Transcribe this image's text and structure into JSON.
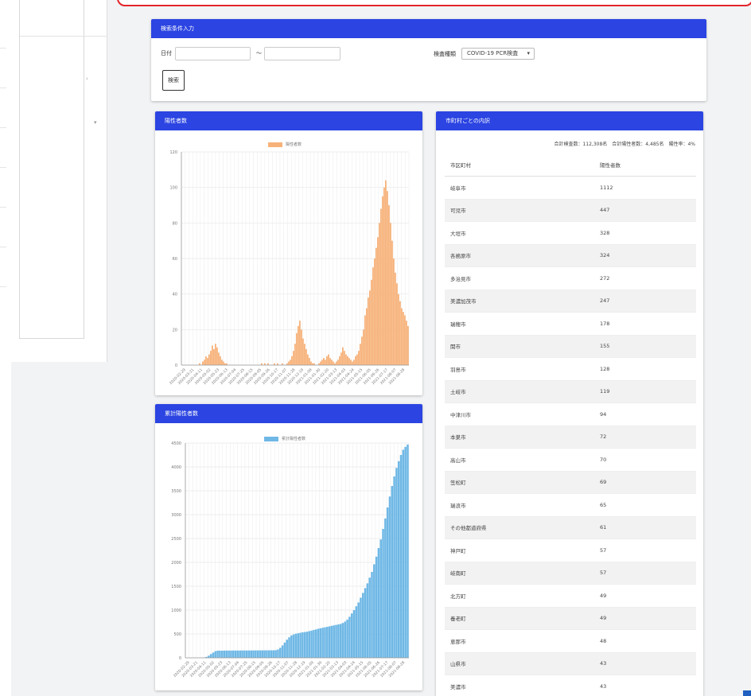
{
  "search": {
    "title": "検索条件入力",
    "date_label": "日付",
    "tilde": "〜",
    "type_label": "検査種類",
    "type_value": "COVID-19 PCR検査",
    "button": "検索"
  },
  "positive_chart": {
    "title": "陽性者数",
    "legend": "陽性者数",
    "color": "#f7b27a"
  },
  "cumulative_chart": {
    "title": "累計陽性者数",
    "legend": "累計陽性者数",
    "color": "#6fb8e6"
  },
  "municipal": {
    "title": "市町村ごとの内訳",
    "totals": "合計検査数：112,308名　合計陽性者数：4,485名　陽性率：4%",
    "headers": [
      "市区町村",
      "陽性者数"
    ],
    "rows": [
      [
        "岐阜市",
        "1112"
      ],
      [
        "可児市",
        "447"
      ],
      [
        "大垣市",
        "328"
      ],
      [
        "各務原市",
        "324"
      ],
      [
        "多治見市",
        "272"
      ],
      [
        "美濃加茂市",
        "247"
      ],
      [
        "瑞穂市",
        "178"
      ],
      [
        "関市",
        "155"
      ],
      [
        "羽島市",
        "128"
      ],
      [
        "土岐市",
        "119"
      ],
      [
        "中津川市",
        "94"
      ],
      [
        "本巣市",
        "72"
      ],
      [
        "高山市",
        "70"
      ],
      [
        "笠松町",
        "69"
      ],
      [
        "瑞浪市",
        "65"
      ],
      [
        "その他都道府県",
        "61"
      ],
      [
        "神戸町",
        "57"
      ],
      [
        "岐南町",
        "57"
      ],
      [
        "北方町",
        "49"
      ],
      [
        "養老町",
        "49"
      ],
      [
        "恵那市",
        "48"
      ],
      [
        "山県市",
        "43"
      ],
      [
        "美濃市",
        "43"
      ]
    ]
  },
  "chart_data": [
    {
      "type": "bar",
      "title": "陽性者数",
      "series": [
        {
          "name": "陽性者数",
          "color": "#f7b27a"
        }
      ],
      "ylim": [
        0,
        120
      ],
      "yticks": [
        "0",
        "20",
        "40",
        "60",
        "80",
        "100",
        "120"
      ],
      "xticks": [
        "2020-02-29",
        "2020-03-21",
        "2020-04-11",
        "2020-05-02",
        "2020-05-23",
        "2020-06-13",
        "2020-07-04",
        "2020-07-25",
        "2020-08-15",
        "2020-09-05",
        "2020-09-26",
        "2020-10-17",
        "2020-11-07",
        "2020-11-28",
        "2020-12-19",
        "2021-01-09",
        "2021-01-30",
        "2021-02-20",
        "2021-03-13",
        "2021-04-03",
        "2021-04-24",
        "2021-05-15",
        "2021-06-05",
        "2021-06-26",
        "2021-07-17",
        "2021-08-07",
        "2021-08-28"
      ],
      "values": [
        0,
        0,
        0,
        0,
        0,
        0,
        0,
        0,
        0,
        0,
        0,
        1,
        0,
        2,
        3,
        5,
        4,
        6,
        8,
        11,
        9,
        12,
        10,
        7,
        5,
        3,
        2,
        1,
        1,
        0,
        0,
        0,
        0,
        0,
        0,
        0,
        0,
        0,
        0,
        0,
        0,
        0,
        0,
        0,
        0,
        0,
        0,
        0,
        0,
        0,
        1,
        0,
        1,
        0,
        1,
        0,
        0,
        0,
        1,
        0,
        1,
        0,
        0,
        1,
        0,
        0,
        1,
        2,
        3,
        5,
        8,
        12,
        18,
        22,
        25,
        20,
        15,
        12,
        9,
        6,
        4,
        2,
        1,
        1,
        0,
        0,
        1,
        2,
        3,
        4,
        3,
        5,
        6,
        4,
        3,
        2,
        1,
        2,
        3,
        5,
        7,
        10,
        8,
        6,
        5,
        4,
        3,
        2,
        3,
        5,
        6,
        8,
        12,
        16,
        20,
        28,
        32,
        38,
        42,
        48,
        55,
        60,
        66,
        72,
        80,
        88,
        95,
        100,
        104,
        98,
        90,
        80,
        70,
        60,
        52,
        46,
        40,
        36,
        32,
        30,
        28,
        25,
        22
      ]
    },
    {
      "type": "area",
      "title": "累計陽性者数",
      "series": [
        {
          "name": "累計陽性者数",
          "color": "#6fb8e6"
        }
      ],
      "ylim": [
        0,
        4500
      ],
      "yticks": [
        "0",
        "500",
        "1000",
        "1500",
        "2000",
        "2500",
        "3000",
        "3500",
        "4000",
        "4500"
      ],
      "xticks": [
        "2020-02-29",
        "2020-03-21",
        "2020-04-11",
        "2020-05-02",
        "2020-05-23",
        "2020-06-13",
        "2020-07-04",
        "2020-07-25",
        "2020-08-15",
        "2020-09-05",
        "2020-09-26",
        "2020-10-17",
        "2020-11-07",
        "2020-11-28",
        "2020-12-19",
        "2021-01-09",
        "2021-01-30",
        "2021-02-20",
        "2021-03-13",
        "2021-04-03",
        "2021-04-24",
        "2021-05-15",
        "2021-06-05",
        "2021-06-26",
        "2021-07-17",
        "2021-08-07",
        "2021-08-28"
      ],
      "values": [
        0,
        0,
        0,
        0,
        0,
        0,
        0,
        2,
        5,
        20,
        45,
        80,
        110,
        140,
        150,
        150,
        150,
        152,
        152,
        152,
        152,
        153,
        153,
        153,
        153,
        154,
        154,
        154,
        155,
        155,
        155,
        156,
        156,
        156,
        157,
        157,
        157,
        158,
        158,
        158,
        160,
        175,
        210,
        260,
        320,
        380,
        430,
        470,
        490,
        505,
        515,
        525,
        535,
        540,
        548,
        560,
        570,
        585,
        595,
        610,
        620,
        630,
        640,
        650,
        660,
        670,
        680,
        690,
        700,
        710,
        730,
        760,
        800,
        860,
        930,
        1000,
        1080,
        1160,
        1260,
        1360,
        1460,
        1560,
        1680,
        1800,
        1960,
        2120,
        2300,
        2480,
        2700,
        2920,
        3150,
        3380,
        3600,
        3800,
        3980,
        4120,
        4250,
        4360,
        4420,
        4470
      ]
    }
  ]
}
